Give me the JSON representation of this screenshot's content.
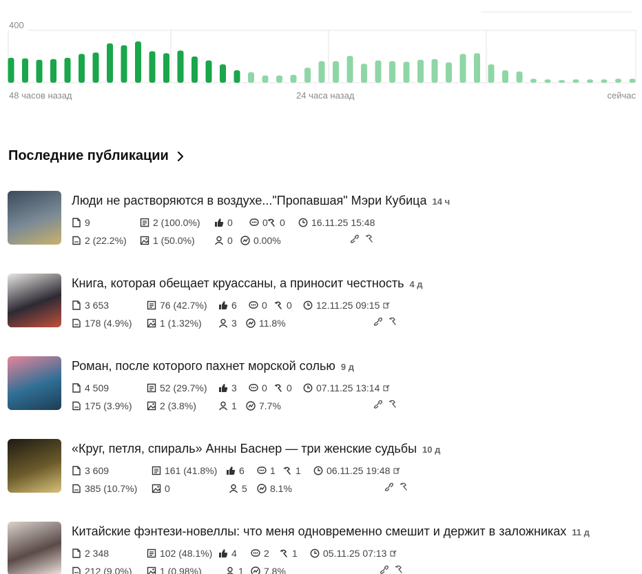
{
  "chart_data": {
    "type": "bar",
    "ylim": [
      0,
      400
    ],
    "y_ticks": [
      "400",
      "0"
    ],
    "x_tick_labels": [
      "48 часов назад",
      "24 часа назад",
      "сейчас"
    ],
    "grid": true,
    "series": [
      {
        "values": [
          190,
          185,
          175,
          180,
          190,
          220,
          230,
          300,
          285,
          315,
          240,
          225,
          245,
          200,
          170,
          140,
          95
        ]
      },
      {
        "values": [
          80,
          55,
          55,
          60,
          115,
          165,
          165,
          205,
          145,
          170,
          165,
          160,
          175,
          180,
          155,
          220,
          225,
          140,
          95,
          85,
          30,
          25,
          20,
          25,
          25,
          25,
          30,
          30
        ]
      }
    ],
    "colors": {
      "recent_48_24": "#1aa64a",
      "recent_24_0": "#8fd6a6"
    }
  },
  "section": {
    "title": "Последние публикации"
  },
  "publications": [
    {
      "title": "Люди не растворяются в воздухе...\"Пропавшая\" Мэри Кубица",
      "age": "14 ч",
      "views": "9",
      "reads": "2 (100.0%)",
      "likes": "0",
      "comments": "0",
      "reposts": "0",
      "date": "16.11.25 15:48",
      "clicks": "2 (22.2%)",
      "photos": "1 (50.0%)",
      "subs": "0",
      "er": "0.00%",
      "thumb_colors": [
        "#3a4a5c",
        "#7b8a96",
        "#c9b26a"
      ]
    },
    {
      "title": "Книга, которая обещает круассаны, а приносит честность",
      "age": "4 д",
      "views": "3 653",
      "reads": "76 (42.7%)",
      "likes": "6",
      "comments": "0",
      "reposts": "0",
      "date": "12.11.25 09:15",
      "clicks": "178 (4.9%)",
      "photos": "1 (1.32%)",
      "subs": "3",
      "er": "11.8%",
      "thumb_colors": [
        "#e8e6e2",
        "#2d2a33",
        "#c4513e"
      ]
    },
    {
      "title": "Роман, после которого пахнет морской солью",
      "age": "9 д",
      "views": "4 509",
      "reads": "52 (29.7%)",
      "likes": "3",
      "comments": "0",
      "reposts": "0",
      "date": "07.11.25 13:14",
      "clicks": "175 (3.9%)",
      "photos": "2 (3.8%)",
      "subs": "1",
      "er": "7.7%",
      "thumb_colors": [
        "#e8849a",
        "#2f6f95",
        "#1e3d55"
      ]
    },
    {
      "title": "«Круг, петля, спираль» Анны Баснер — три женские судьбы",
      "age": "10 д",
      "views": "3 609",
      "reads": "161 (41.8%)",
      "likes": "6",
      "comments": "1",
      "reposts": "1",
      "date": "06.11.25 19:48",
      "clicks": "385 (10.7%)",
      "photos": "0",
      "subs": "5",
      "er": "8.1%",
      "thumb_colors": [
        "#1c1a14",
        "#6b5a2a",
        "#d7c27a"
      ]
    },
    {
      "title": "Китайские фэнтези-новеллы: что меня одновременно смешит и держит в заложниках",
      "age": "11 д",
      "views": "2 348",
      "reads": "102 (48.1%)",
      "likes": "4",
      "comments": "2",
      "reposts": "1",
      "date": "05.11.25 07:13",
      "clicks": "212 (9.0%)",
      "photos": "1 (0.98%)",
      "subs": "1",
      "er": "7.8%",
      "thumb_colors": [
        "#d9d3cd",
        "#5a4a48",
        "#f1e6e0"
      ]
    }
  ]
}
